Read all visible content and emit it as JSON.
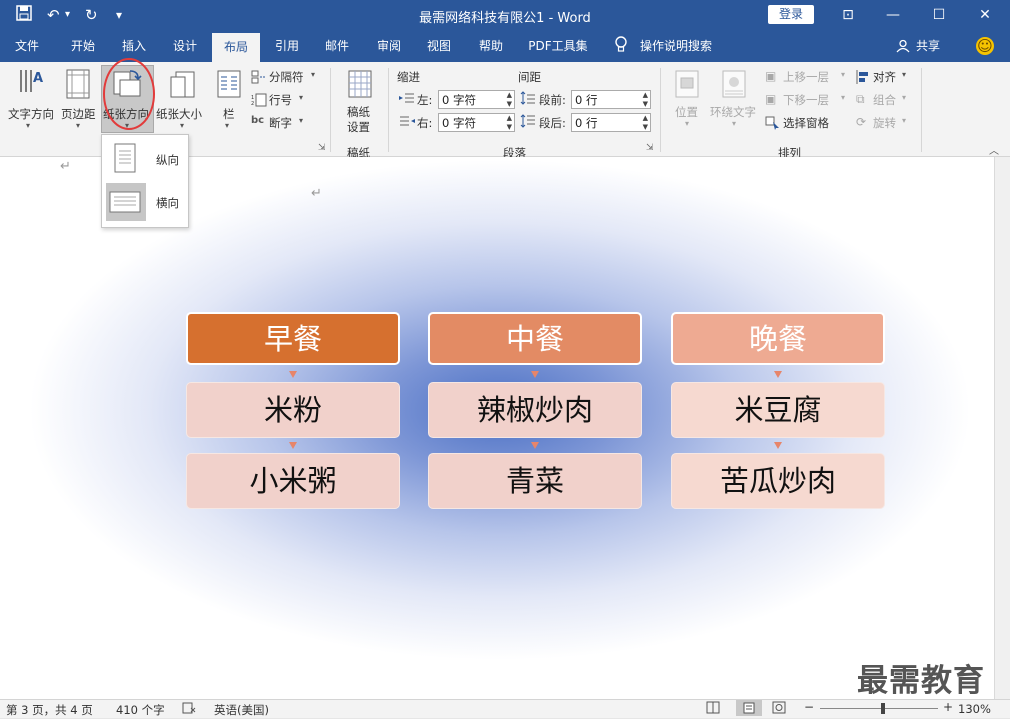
{
  "window": {
    "title": "最需网络科技有限公1 - Word",
    "login_label": "登录",
    "quick_access": {
      "save_icon": "💾",
      "undo_icon": "↶",
      "redo_icon": "↻",
      "customize_icon": "▾"
    },
    "controls": {
      "ribbon_display_icon": "⊡",
      "minimize_icon": "—",
      "maximize_icon": "☐",
      "close_icon": "✕"
    }
  },
  "tabs": [
    {
      "label": "文件"
    },
    {
      "label": "开始"
    },
    {
      "label": "插入"
    },
    {
      "label": "设计"
    },
    {
      "label": "布局",
      "active": true
    },
    {
      "label": "引用"
    },
    {
      "label": "邮件"
    },
    {
      "label": "审阅"
    },
    {
      "label": "视图"
    },
    {
      "label": "帮助"
    },
    {
      "label": "PDF工具集"
    }
  ],
  "tell_me": {
    "icon": "💡",
    "label": "操作说明搜索"
  },
  "share": {
    "icon": "👤",
    "label": "共享"
  },
  "smiley_icon": "☺",
  "ribbon": {
    "page_setup": {
      "text_direction": "文字方向",
      "margins": "页边距",
      "orientation": "纸张方向",
      "size": "纸张大小",
      "columns": "栏",
      "breaks": "分隔符",
      "line_numbers": "行号",
      "hyphenation": "断字"
    },
    "manuscript": {
      "button_line1": "稿纸",
      "button_line2": "设置",
      "group_label": "稿纸"
    },
    "paragraph": {
      "indent_label": "缩进",
      "spacing_label": "间距",
      "left_label": "左:",
      "right_label": "右:",
      "before_label": "段前:",
      "after_label": "段后:",
      "left_value": "0 字符",
      "right_value": "0 字符",
      "before_value": "0 行",
      "after_value": "0 行",
      "group_label": "段落"
    },
    "arrange": {
      "position": "位置",
      "wrap_text": "环绕文字",
      "bring_forward": "上移一层",
      "send_backward": "下移一层",
      "selection_pane": "选择窗格",
      "align": "对齐",
      "group": "组合",
      "rotate": "旋转",
      "group_label": "排列"
    }
  },
  "orientation_menu": {
    "portrait": "纵向",
    "landscape": "横向"
  },
  "document": {
    "pilcrow": "↵",
    "columns": [
      {
        "header": "早餐",
        "items": [
          "米粉",
          "小米粥"
        ],
        "header_color": "#d6702f"
      },
      {
        "header": "中餐",
        "items": [
          "辣椒炒肉",
          "青菜"
        ],
        "header_color": "#e38b64"
      },
      {
        "header": "晚餐",
        "items": [
          "米豆腐",
          "苦瓜炒肉"
        ],
        "header_color": "#eeaa92"
      }
    ]
  },
  "statusbar": {
    "page_info": "第 3 页，共 4 页",
    "word_count": "410 个字",
    "language": "英语(美国)",
    "zoom": "130%",
    "zoom_minus": "−",
    "zoom_plus": "+"
  },
  "watermark": "最需教育",
  "colors": {
    "titlebar": "#2b579a",
    "highlight_circle": "#e23b3b"
  }
}
